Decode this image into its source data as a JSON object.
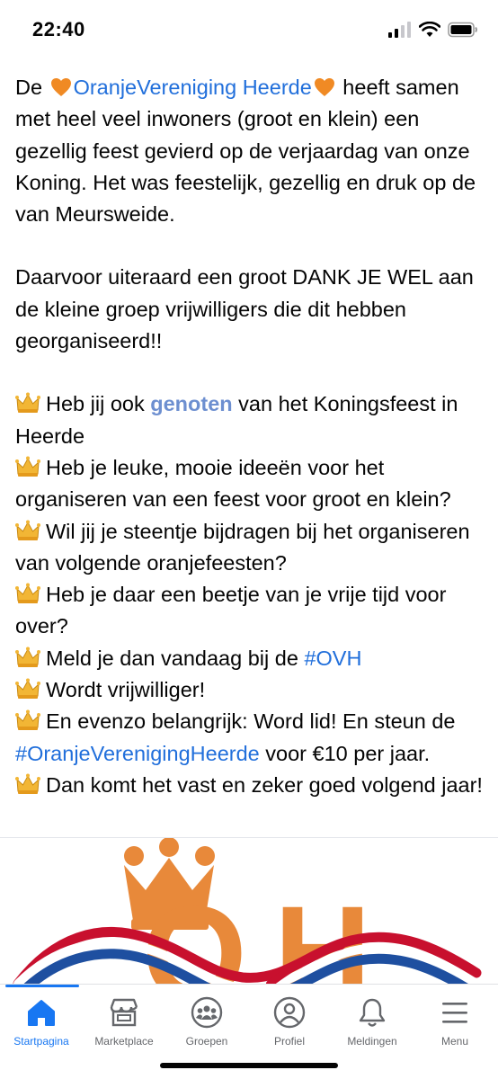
{
  "status_bar": {
    "time": "22:40"
  },
  "post": {
    "intro_before": "De ",
    "intro_link": "OranjeVereniging Heerde",
    "intro_after": " heeft samen met heel veel inwoners (groot en klein) een gezellig feest gevierd op de verjaardag van onze Koning. Het was feestelijk, gezellig en druk op de van Meursweide.",
    "thanks": "Daarvoor uiteraard een groot DANK JE WEL aan de kleine groep vrijwilligers die dit hebben georganiseerd!!",
    "q1_before": "Heb jij ook ",
    "q1_link": "genoten",
    "q1_after": " van het Koningsfeest in Heerde",
    "q2": "Heb je leuke, mooie ideeën voor het organiseren van een feest voor groot en klein?",
    "q3": "Wil jij je steentje bijdragen bij het organiseren van volgende oranjefeesten?",
    "q4": "Heb je daar een beetje van je vrije tijd voor over?",
    "q5_before": "Meld je dan vandaag bij de ",
    "q5_link": "#OVH",
    "q6": "Wordt vrijwilliger!",
    "q7_before": "En evenzo belangrijk: Word lid! En steun de ",
    "q7_link": "#OranjeVerenigingHeerde",
    "q7_after": " voor €10 per jaar.",
    "q8": "Dan komt het vast en zeker goed volgend jaar!",
    "logo_letters": "OH"
  },
  "tabs": [
    {
      "label": "Startpagina",
      "icon": "home-icon",
      "active": true
    },
    {
      "label": "Marketplace",
      "icon": "marketplace-icon",
      "active": false
    },
    {
      "label": "Groepen",
      "icon": "groups-icon",
      "active": false
    },
    {
      "label": "Profiel",
      "icon": "profile-icon",
      "active": false
    },
    {
      "label": "Meldingen",
      "icon": "bell-icon",
      "active": false
    },
    {
      "label": "Menu",
      "icon": "menu-icon",
      "active": false
    }
  ],
  "colors": {
    "accent": "#1877f2",
    "link": "#216fdb",
    "orange": "#e8893a",
    "crown": "#f2b635"
  }
}
